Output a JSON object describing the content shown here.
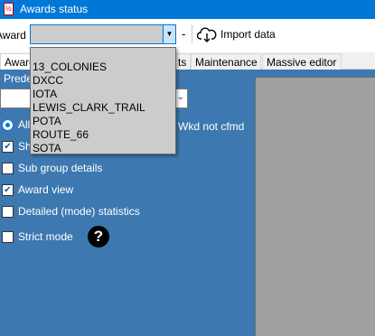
{
  "window": {
    "title": "Awards status",
    "app_icon_text": "½"
  },
  "toolbar": {
    "award_label": "Award",
    "award_selected": "",
    "dash": "-",
    "import_label": "Import data"
  },
  "award_options": [
    "13_COLONIES",
    "DXCC",
    "IOTA",
    "LEWIS_CLARK_TRAIL",
    "POTA",
    "ROUTE_66",
    "SOTA"
  ],
  "tabs": [
    {
      "label": "Award"
    },
    {
      "label": "ts"
    },
    {
      "label": "Maintenance"
    },
    {
      "label": "Massive editor"
    }
  ],
  "panel": {
    "predefined_label": "Prede",
    "predefined_value": "",
    "radio_all_label": "All",
    "wkd_label": "Wkd not cfmd",
    "options": [
      {
        "label": "Sh",
        "checked": true
      },
      {
        "label": "Sub group details",
        "checked": false
      },
      {
        "label": "Award view",
        "checked": true
      },
      {
        "label": "Detailed (mode) statistics",
        "checked": false
      },
      {
        "label": "Strict mode",
        "checked": false
      }
    ],
    "help_icon": "?"
  },
  "colors": {
    "titlebar": "#0078d7",
    "panel": "#3d79b0",
    "dropdown": "#cccccc"
  }
}
